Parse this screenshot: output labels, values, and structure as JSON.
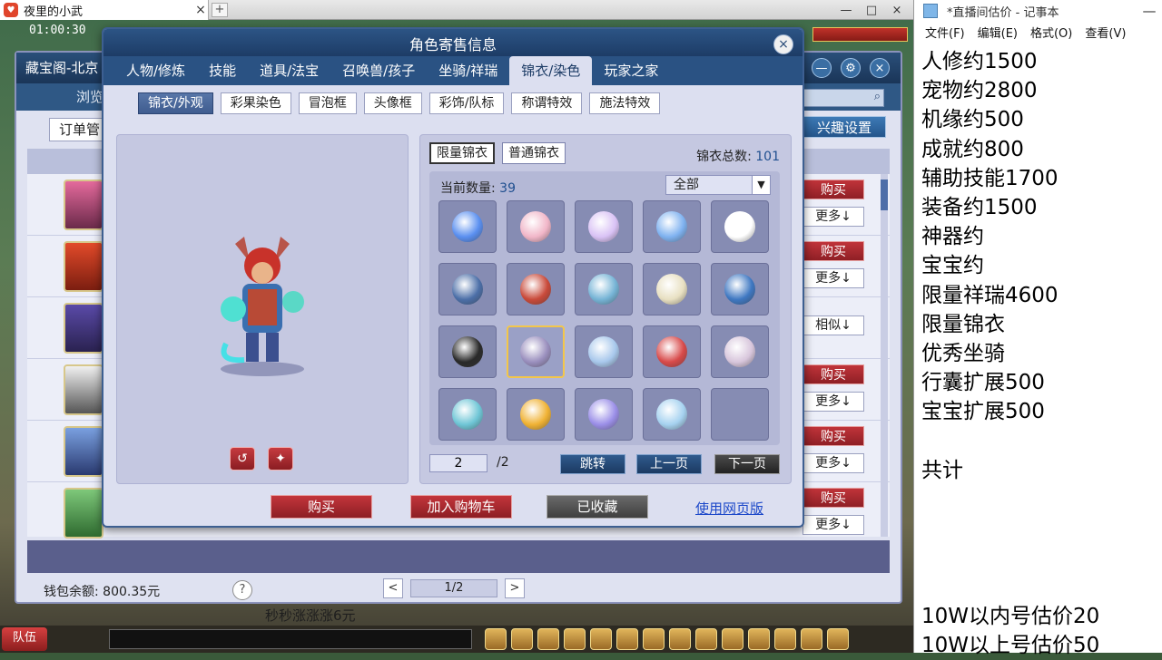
{
  "browser": {
    "tab_title": "夜里的小武",
    "tab_close": "×",
    "new_tab": "+",
    "controls": [
      "—",
      "□",
      "×"
    ]
  },
  "game": {
    "clock": "01:00:30",
    "hud_team": "队伍",
    "hud_text": "秒秒涨涨涨6元"
  },
  "cbg": {
    "title": "藏宝阁-北京",
    "nav_text": "浏览",
    "toolbar_label": "订单管",
    "interest_label": "兴趣设置",
    "search_icon": "search-icon",
    "rows": [
      {
        "buy": "购买",
        "more": "更多↓"
      },
      {
        "buy": "购买",
        "more": "更多↓"
      },
      {
        "buy": "",
        "more": "相似↓"
      },
      {
        "buy": "购买",
        "more": "更多↓"
      },
      {
        "buy": "购买",
        "more": "更多↓"
      },
      {
        "buy": "购买",
        "more": "更多↓"
      }
    ],
    "wallet": "钱包余额: 800.35元",
    "help": "?",
    "pager": {
      "prev": "<",
      "page": "1/2",
      "next": ">"
    }
  },
  "dialog": {
    "title": "角色寄售信息",
    "close": "×",
    "main_tabs": [
      "人物/修炼",
      "技能",
      "道具/法宝",
      "召唤兽/孩子",
      "坐骑/祥瑞",
      "锦衣/染色",
      "玩家之家"
    ],
    "active_main_tab": "锦衣/染色",
    "sub_tabs": [
      "锦衣/外观",
      "彩果染色",
      "冒泡框",
      "头像框",
      "彩饰/队标",
      "称谓特效",
      "施法特效"
    ],
    "active_sub_tab": "锦衣/外观",
    "preview_buttons": {
      "rotate": "↺",
      "action": "✦"
    },
    "wardrobe": {
      "tabs": [
        "限量锦衣",
        "普通锦衣"
      ],
      "active_tab": "限量锦衣",
      "total_label": "锦衣总数:",
      "total_value": "101",
      "current_label": "当前数量:",
      "current_value": "39",
      "filter": "全部",
      "filter_icon": "chevron-down-icon",
      "slot_colors": [
        "#5a8ff0",
        "#f1b6c8",
        "#d9c2f5",
        "#7fb2f0",
        "#ffffff",
        "#4c6fa8",
        "#c94a3a",
        "#76b4d6",
        "#e8e0c2",
        "#3f78c2",
        "#2a2a2a",
        "#9a8fbe",
        "#a8c8ec",
        "#d84a4a",
        "#d8c6dc",
        "#6fc6d6",
        "#f0b234",
        "#9b8fe8",
        "#a6d2f0",
        ""
      ],
      "selected_slot": 11,
      "page_current": "2",
      "page_total": "/2",
      "jump": "跳转",
      "prev": "上一页",
      "next": "下一页"
    },
    "actions": {
      "buy": "购买",
      "add_cart": "加入购物车",
      "favorited": "已收藏",
      "web_version": "使用网页版"
    }
  },
  "notepad": {
    "title": "*直播间估价 - 记事本",
    "min": "—",
    "menu": [
      "文件(F)",
      "编辑(E)",
      "格式(O)",
      "查看(V)"
    ],
    "lines": [
      "人修约1500",
      "宠物约2800",
      "机缘约500",
      "成就约800",
      "辅助技能1700",
      "装备约1500",
      "神器约",
      "宝宝约",
      "限量祥瑞4600",
      "限量锦衣",
      "优秀坐骑",
      "行囊扩展500",
      "宝宝扩展500",
      "",
      "共计",
      "",
      "",
      "",
      "",
      "10W以内号估价20",
      "10W以上号估价50"
    ]
  }
}
